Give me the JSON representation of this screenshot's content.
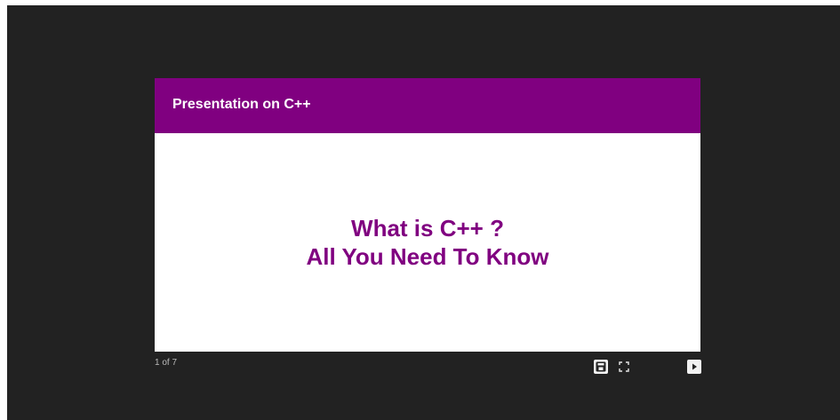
{
  "slide": {
    "header_title": "Presentation on C++",
    "lines": [
      "What is C++ ?",
      "All You Need To Know"
    ]
  },
  "controls": {
    "page_counter": "1 of 7",
    "current_page": 1,
    "total_pages": 7,
    "icons": {
      "save": "save-icon",
      "fullscreen": "fullscreen-icon",
      "next": "next-slide-icon"
    }
  },
  "colors": {
    "viewer_background": "#222222",
    "header_background": "#800080",
    "title_text": "#800080",
    "header_text": "#ffffff"
  }
}
